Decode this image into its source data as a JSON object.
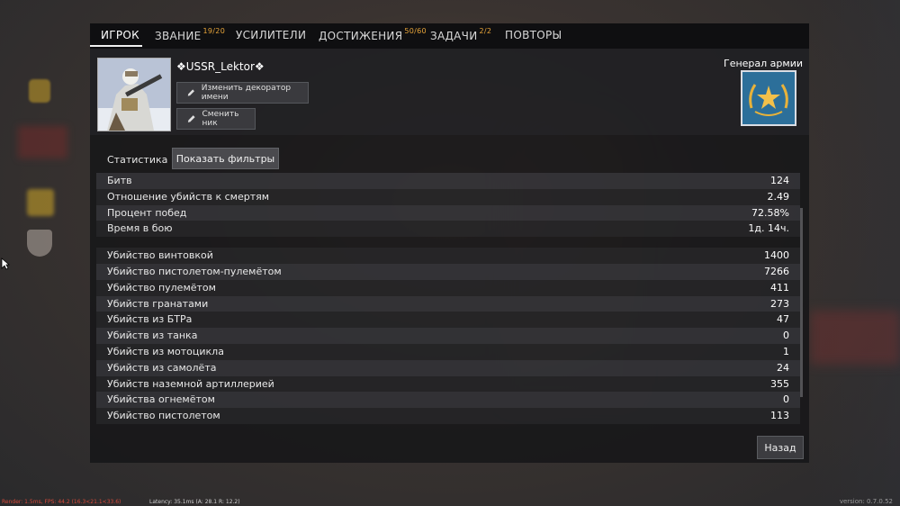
{
  "tabs": [
    {
      "label": "ИГРОК",
      "badge": ""
    },
    {
      "label": "ЗВАНИЕ",
      "badge": "19/20"
    },
    {
      "label": "УСИЛИТЕЛИ",
      "badge": ""
    },
    {
      "label": "ДОСТИЖЕНИЯ",
      "badge": "50/60"
    },
    {
      "label": "ЗАДАЧИ",
      "badge": "2/2"
    },
    {
      "label": "ПОВТОРЫ",
      "badge": ""
    }
  ],
  "player": {
    "nickname": "❖USSR_Lektor❖",
    "change_decorator_label": "Изменить декоратор имени",
    "change_nick_label": "Сменить ник"
  },
  "rank": {
    "title": "Генерал армии",
    "badge_color": "#2c6f9a",
    "emblem_color": "#e8b23a"
  },
  "stats": {
    "label": "Статистика",
    "filter_button": "Показать фильтры",
    "general": [
      {
        "label": "Битв",
        "value": "124"
      },
      {
        "label": "Отношение убийств к смертям",
        "value": "2.49"
      },
      {
        "label": "Процент побед",
        "value": "72.58%"
      },
      {
        "label": "Время в бою",
        "value": "1д. 14ч."
      }
    ],
    "kills": [
      {
        "label": "Убийство винтовкой",
        "value": "1400"
      },
      {
        "label": "Убийство пистолетом-пулемётом",
        "value": "7266"
      },
      {
        "label": "Убийство пулемётом",
        "value": "411"
      },
      {
        "label": "Убийств гранатами",
        "value": "273"
      },
      {
        "label": "Убийств из БТРа",
        "value": "47"
      },
      {
        "label": "Убийств из танка",
        "value": "0"
      },
      {
        "label": "Убийств из мотоцикла",
        "value": "1"
      },
      {
        "label": "Убийств из самолёта",
        "value": "24"
      },
      {
        "label": "Убийств наземной артиллерией",
        "value": "355"
      },
      {
        "label": "Убийства огнемётом",
        "value": "0"
      },
      {
        "label": "Убийство пистолетом",
        "value": "113"
      }
    ]
  },
  "back_button": "Назад",
  "footer": {
    "debug": "Render: 1.5ms, FPS: 44.2 (16.3<21.1<33.6)",
    "latency": "Latency: 35.1ms (A: 28.1 R: 12.2)",
    "version": "version: 0.7.0.52"
  }
}
